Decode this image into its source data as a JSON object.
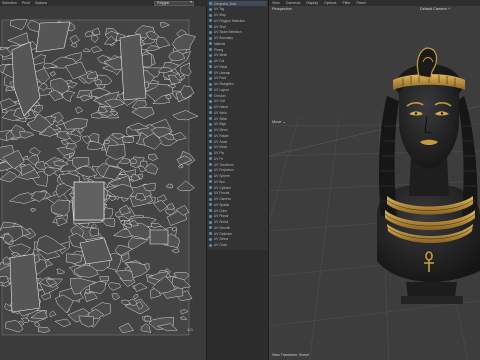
{
  "uv_editor": {
    "menu": [
      "Selection",
      "Pivot",
      "Options"
    ],
    "mode_select": "Polygon",
    "scale_label": "1.0"
  },
  "object_manager": {
    "rows": [
      "Cleopatra_Bust",
      "UV Tag",
      "UV Map",
      "UV Polygon Selection",
      "UV Shell",
      "UV Seam Selection",
      "UV Boundary",
      "Material",
      "Phong",
      "UV Mesh",
      "UV Cut",
      "UV Relax",
      "UV Unwrap",
      "UV Pack",
      "UV Straighten",
      "UV Layout",
      "Checker",
      "UV Grid",
      "UV Island",
      "UV Weld",
      "UV Stitch",
      "UV Align",
      "UV Mirror",
      "UV Rotate",
      "UV Scale",
      "UV Move",
      "UV Flip",
      "UV Fit",
      "UV Transform",
      "UV Projection",
      "UV Sphere",
      "UV Box",
      "UV Cylinder",
      "UV Frontal",
      "UV Camera",
      "UV Spatial",
      "UV Cubic",
      "UV Planar",
      "UV Shrink",
      "UV Smooth",
      "UV Optimize",
      "UV Select",
      "UV Grow"
    ]
  },
  "viewport": {
    "menu": [
      "View",
      "Cameras",
      "Display",
      "Options",
      "Filter",
      "Panel"
    ],
    "perspective_label": "Perspective",
    "camera_label": "Default Camera :*",
    "move_label": "Move ↔",
    "footer": "View Transform: Scene"
  },
  "colors": {
    "uv_bg": "#3b3b3b",
    "uv_line": "#e8e8e8",
    "viewport_bg": "#3d3d3d",
    "bust_skin": "#1f1f20",
    "gold": "#c69a3f"
  }
}
